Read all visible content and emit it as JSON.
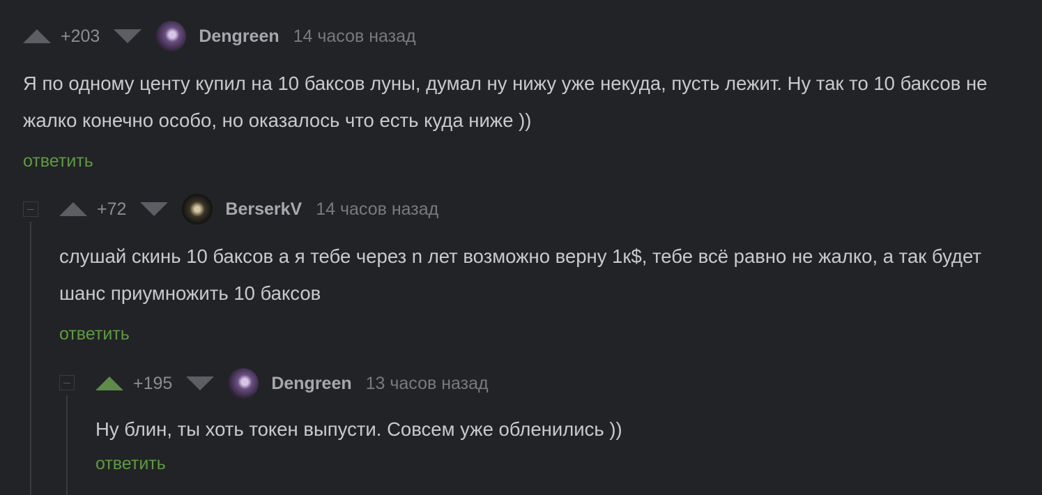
{
  "comments": [
    {
      "rating": "+203",
      "username": "Dengreen",
      "time": "14 часов назад",
      "text": "Я по одному центу купил на 10 баксов луны, думал ну нижу уже некуда, пусть лежит. Ну так то 10 баксов не жалко конечно особо, но оказалось что есть куда ниже ))",
      "reply_label": "ответить"
    },
    {
      "rating": "+72",
      "username": "BerserkV",
      "time": "14 часов назад",
      "text": "слушай скинь 10 баксов а я тебе через n лет возможно верну 1к$, тебе всё равно не жалко, а так будет шанс приумножить 10 баксов",
      "reply_label": "ответить"
    },
    {
      "rating": "+195",
      "username": "Dengreen",
      "time": "13 часов назад",
      "text": "Ну блин, ты хоть токен выпусти. Совсем уже обленились ))",
      "reply_label": "ответить"
    }
  ],
  "colors": {
    "background": "#222326",
    "upvote_active": "#5f8a4a",
    "reply_link": "#5f9a43"
  }
}
